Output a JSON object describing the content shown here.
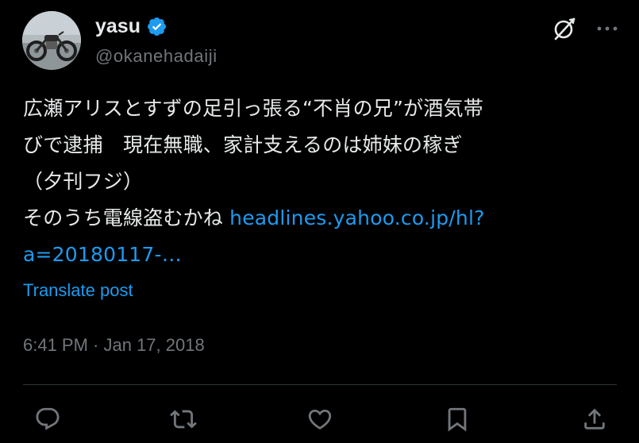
{
  "author": {
    "display_name": "yasu",
    "handle": "@okanehadaiji",
    "verified": true
  },
  "post": {
    "lines": [
      "広瀬アリスとすずの足引っ張る“不肖の兄”が酒気帯",
      "びで逮捕　現在無職、家計支えるのは姉妹の稼ぎ",
      "（夕刊フジ）"
    ],
    "last_line_text": "そのうち電線盗むかね ",
    "link_part1": "headlines.yahoo.co.jp/hl?",
    "link_part2": "a=20180117-…"
  },
  "translate_label": "Translate post",
  "timestamp": "6:41 PM · Jan 17, 2018",
  "icons": {
    "verified": "verified-badge-icon",
    "grok": "grok-icon",
    "more": "more-icon",
    "reply": "reply-icon",
    "repost": "repost-icon",
    "like": "like-icon",
    "bookmark": "bookmark-icon",
    "share": "share-icon"
  },
  "colors": {
    "background": "#000000",
    "text": "#e7e9ea",
    "secondary": "#71767b",
    "accent": "#1d9bf0"
  }
}
